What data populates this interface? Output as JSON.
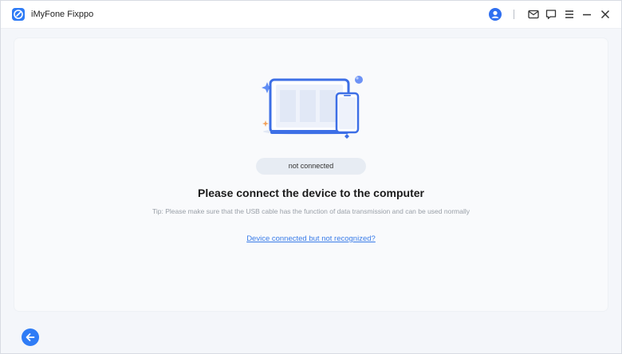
{
  "app": {
    "title": "iMyFone Fixppo"
  },
  "titlebar": {
    "icons": [
      "user-icon",
      "mail-icon",
      "feedback-icon",
      "menu-icon",
      "minimize-icon",
      "close-icon"
    ]
  },
  "main": {
    "status": "not connected",
    "headline": "Please connect the device to the computer",
    "tip": "Tip: Please make sure that the USB cable has the function of data transmission and can be used normally",
    "help_link": "Device connected but not recognized?"
  },
  "footer": {
    "back_icon": "arrow-left-icon"
  },
  "colors": {
    "accent": "#2f7cf6",
    "link": "#3a7ce8",
    "pill_bg": "#e7ecf3"
  }
}
